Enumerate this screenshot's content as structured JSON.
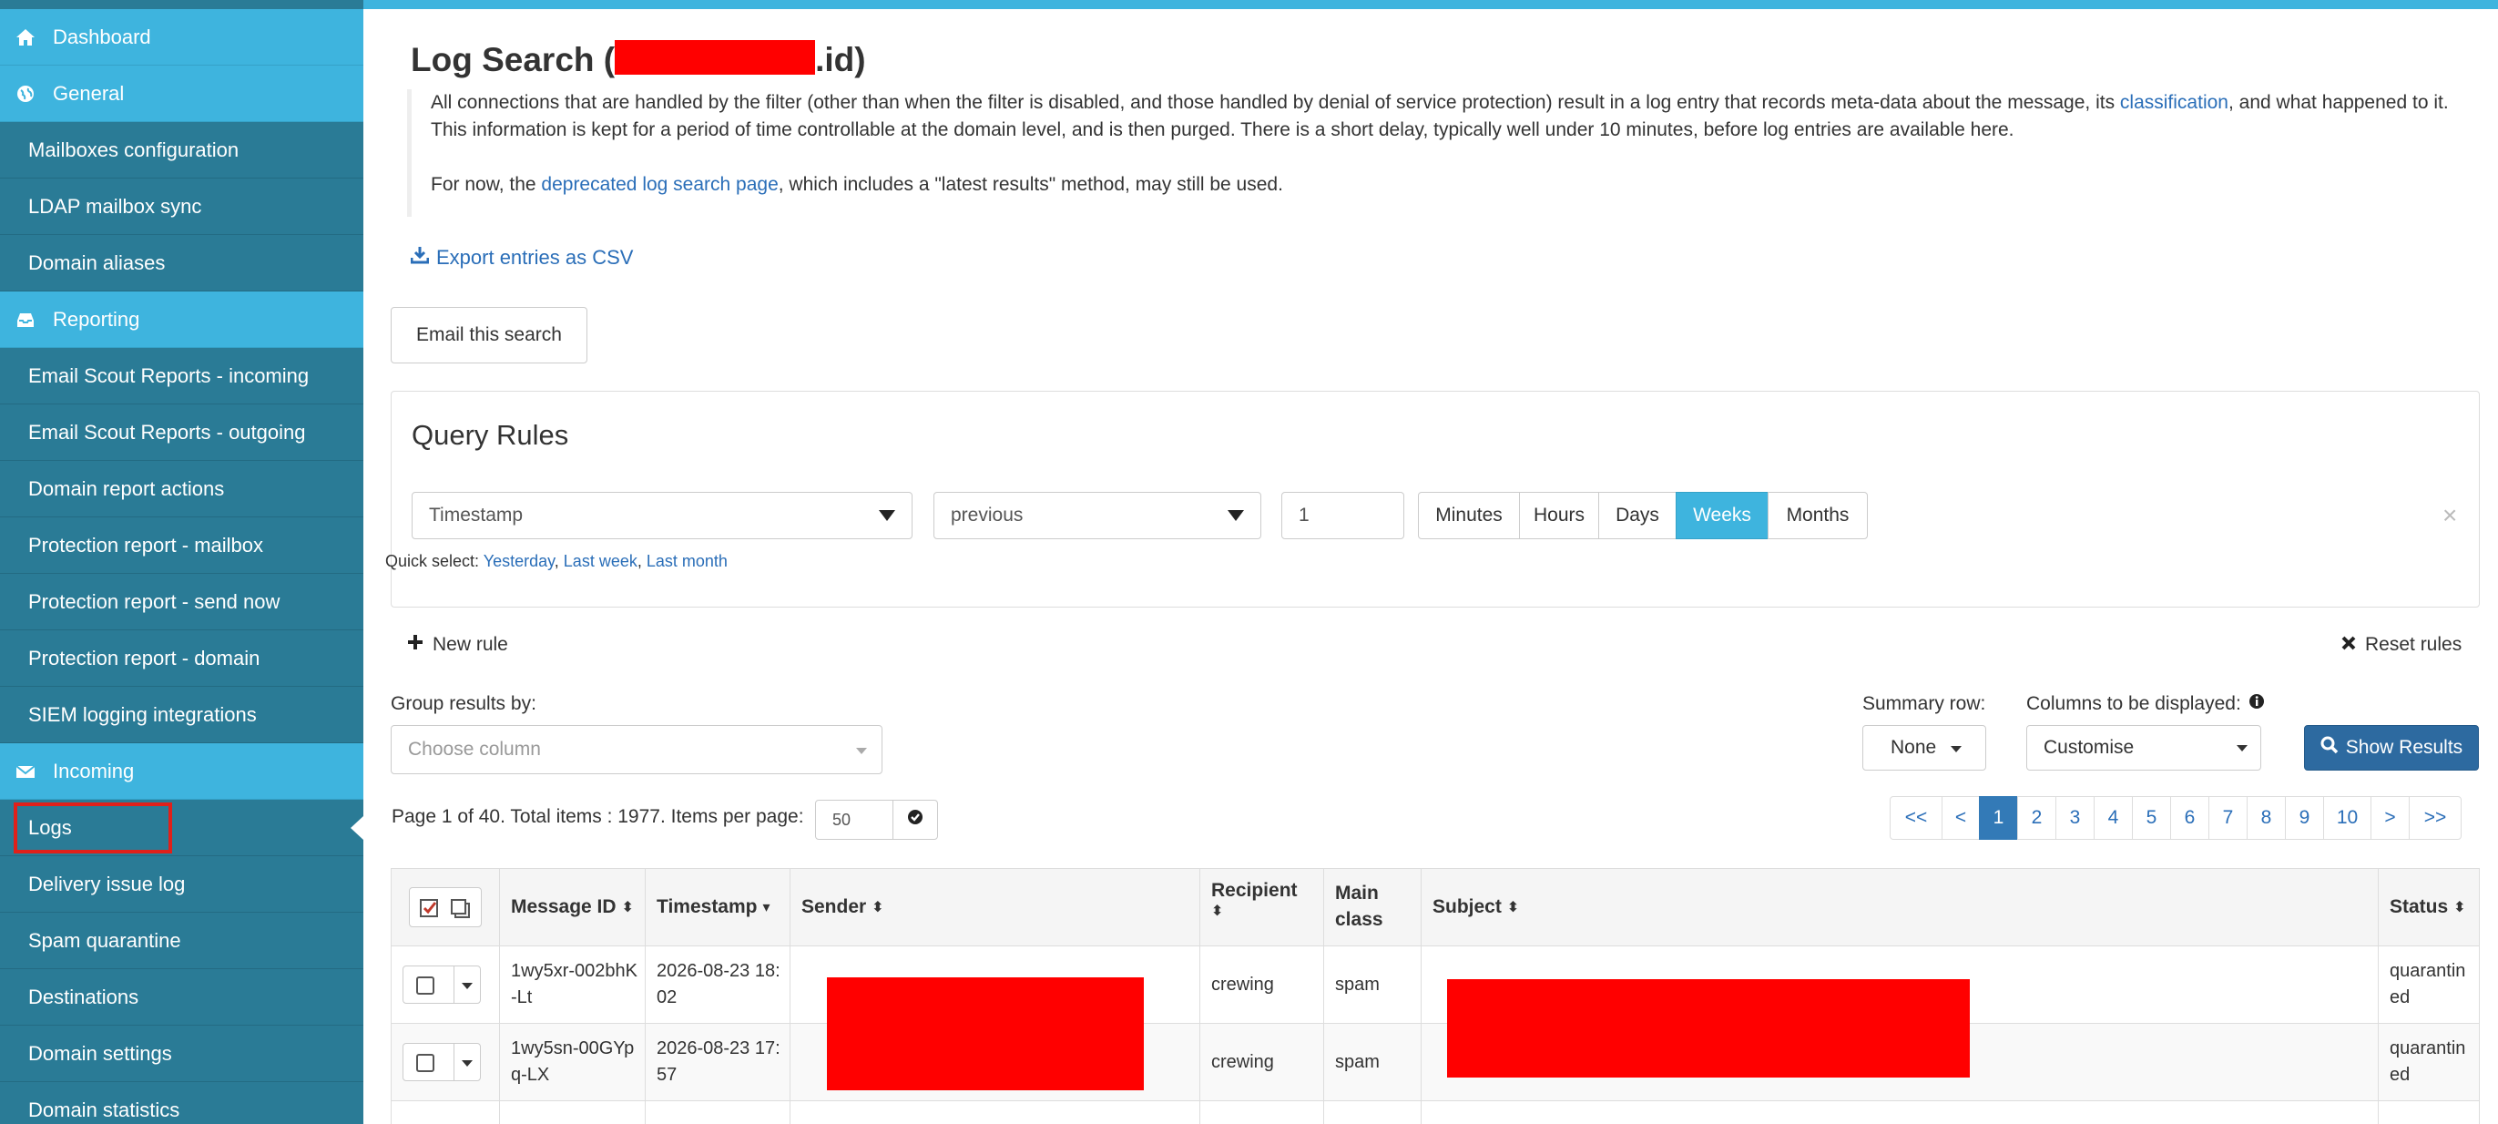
{
  "sidebar": {
    "items": [
      {
        "label": "Dashboard",
        "type": "section",
        "icon": "home-icon"
      },
      {
        "label": "General",
        "type": "section",
        "icon": "globe-icon"
      },
      {
        "label": "Mailboxes configuration",
        "type": "link"
      },
      {
        "label": "LDAP mailbox sync",
        "type": "link"
      },
      {
        "label": "Domain aliases",
        "type": "link"
      },
      {
        "label": "Reporting",
        "type": "section",
        "icon": "inbox-icon"
      },
      {
        "label": "Email Scout Reports - incoming",
        "type": "link"
      },
      {
        "label": "Email Scout Reports - outgoing",
        "type": "link"
      },
      {
        "label": "Domain report actions",
        "type": "link"
      },
      {
        "label": "Protection report - mailbox",
        "type": "link"
      },
      {
        "label": "Protection report - send now",
        "type": "link"
      },
      {
        "label": "Protection report - domain",
        "type": "link"
      },
      {
        "label": "SIEM logging integrations",
        "type": "link"
      },
      {
        "label": "Incoming",
        "type": "section",
        "icon": "envelope-icon"
      },
      {
        "label": "Logs",
        "type": "link",
        "active": true
      },
      {
        "label": "Delivery issue log",
        "type": "link"
      },
      {
        "label": "Spam quarantine",
        "type": "link"
      },
      {
        "label": "Destinations",
        "type": "link"
      },
      {
        "label": "Domain settings",
        "type": "link"
      },
      {
        "label": "Domain statistics",
        "type": "link"
      }
    ]
  },
  "header": {
    "title_prefix": "Log Search (",
    "title_suffix": ".id)"
  },
  "intro": {
    "p1_start": "All connections that are handled by the filter (other than when the filter is disabled, and those handled by denial of service protection) result in a log entry that records meta-data about the message, its ",
    "p1_link": "classification",
    "p1_end": ", and what happened to it.",
    "p1_line2": "This information is kept for a period of time controllable at the domain level, and is then purged. There is a short delay, typically well under 10 minutes, before log entries are available here.",
    "p2_start": "For now, the ",
    "p2_link": "deprecated log search page",
    "p2_end": ", which includes a \"latest results\" method, may still be used."
  },
  "actions": {
    "export_label": "Export entries as CSV",
    "email_search_label": "Email this search"
  },
  "query_rules": {
    "title": "Query Rules",
    "field_value": "Timestamp",
    "operator_value": "previous",
    "amount_value": "1",
    "units": [
      "Minutes",
      "Hours",
      "Days",
      "Weeks",
      "Months"
    ],
    "active_unit": "Weeks",
    "quick_select_label": "Quick select: ",
    "quick_select": [
      "Yesterday",
      "Last week",
      "Last month"
    ],
    "remove_symbol": "×",
    "new_rule_label": "New rule",
    "reset_rules_label": "Reset rules"
  },
  "options": {
    "group_by_label": "Group results by:",
    "group_by_placeholder": "Choose column",
    "summary_row_label": "Summary row:",
    "summary_row_value": "None",
    "columns_label": "Columns to be displayed:",
    "columns_value": "Customise",
    "show_results_label": "Show Results"
  },
  "pagination": {
    "summary": "Page 1 of 40. Total items : 1977. Items per page:",
    "items_per_page": "50",
    "pages": [
      "<<",
      "<",
      "1",
      "2",
      "3",
      "4",
      "5",
      "6",
      "7",
      "8",
      "9",
      "10",
      ">",
      ">>"
    ],
    "current_page": "1"
  },
  "table": {
    "columns": [
      "Message ID",
      "Timestamp",
      "Sender",
      "Recipient",
      "Main class",
      "Subject",
      "Status"
    ],
    "rows": [
      {
        "message_id": "1wy5xr-002bhK-Lt",
        "timestamp": "2026-08-23 18:02",
        "recipient": "crewing",
        "main_class": "spam",
        "status": "quarantined"
      },
      {
        "message_id": "1wy5sn-00GYpq-LX",
        "timestamp": "2026-08-23 17:57",
        "recipient": "crewing",
        "main_class": "spam",
        "status": "quarantined"
      }
    ]
  },
  "colors": {
    "sidebar_bg": "#2a7b96",
    "section_bg": "#3eb4de",
    "accent": "#3eb4de",
    "primary_button": "#2d6aa0",
    "link": "#2a6eb8",
    "redaction": "#ff0000"
  }
}
